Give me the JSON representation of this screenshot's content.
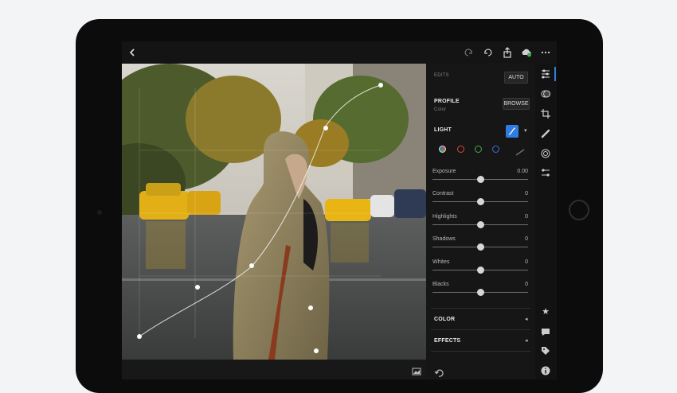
{
  "panel": {
    "edits_label": "EDITS",
    "auto_label": "AUTO",
    "profile_label": "PROFILE",
    "profile_value": "Color",
    "browse_label": "BROWSE",
    "light_label": "LIGHT",
    "sliders": [
      {
        "name": "Exposure",
        "value": "0.00",
        "position": 0.5
      },
      {
        "name": "Contrast",
        "value": "0",
        "position": 0.5
      },
      {
        "name": "Highlights",
        "value": "0",
        "position": 0.5
      },
      {
        "name": "Shadows",
        "value": "0",
        "position": 0.5
      },
      {
        "name": "Whites",
        "value": "0",
        "position": 0.5
      },
      {
        "name": "Blacks",
        "value": "0",
        "position": 0.5
      }
    ],
    "color_label": "COLOR",
    "effects_label": "EFFECTS"
  },
  "colors": {
    "accent": "#2f7de1",
    "curve_red": "#e0453a",
    "curve_green": "#3fae4a",
    "curve_blue": "#3a72d8"
  },
  "icons": {
    "back": "chevron-left-icon",
    "undo": "undo-icon",
    "redo": "redo-icon",
    "share": "share-icon",
    "cloud": "cloud-sync-icon",
    "more": "more-icon"
  }
}
